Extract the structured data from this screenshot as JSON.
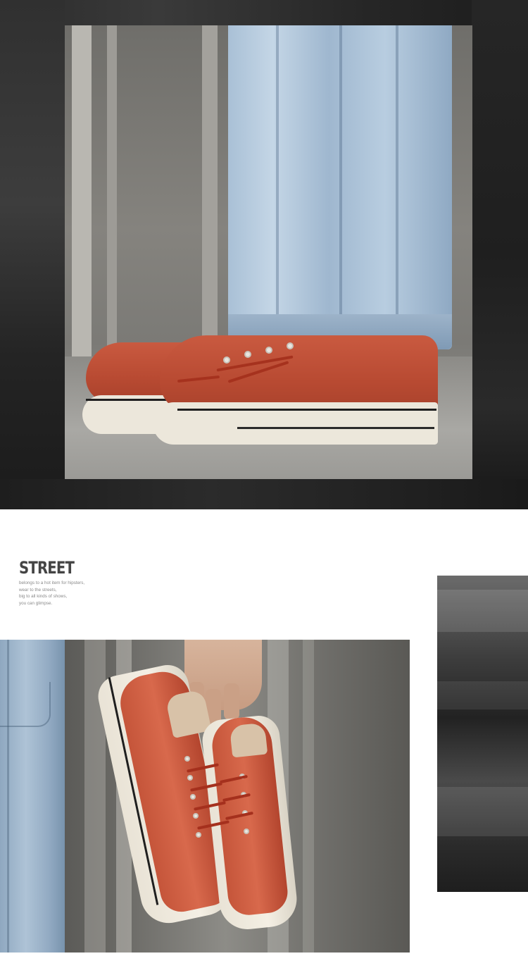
{
  "section": {
    "title": "STREET",
    "description_lines": [
      "belongs to a hot item for hipsters,",
      " wear to the streets,",
      "big to all kinds of shows,",
      "you can glimpse."
    ]
  },
  "images": {
    "top": "photo of legs in light blue jeans wearing orange-red suede low-top sneakers",
    "bottom": "photo of a hand holding a pair of orange-red suede low-top sneakers",
    "side": "dark blurred street photo strip"
  },
  "colors": {
    "shoe": "#c4533a",
    "sole": "#ece7db",
    "denim": "#a9c0d6",
    "title_text": "#444444",
    "body_text": "#8a8a8a"
  }
}
